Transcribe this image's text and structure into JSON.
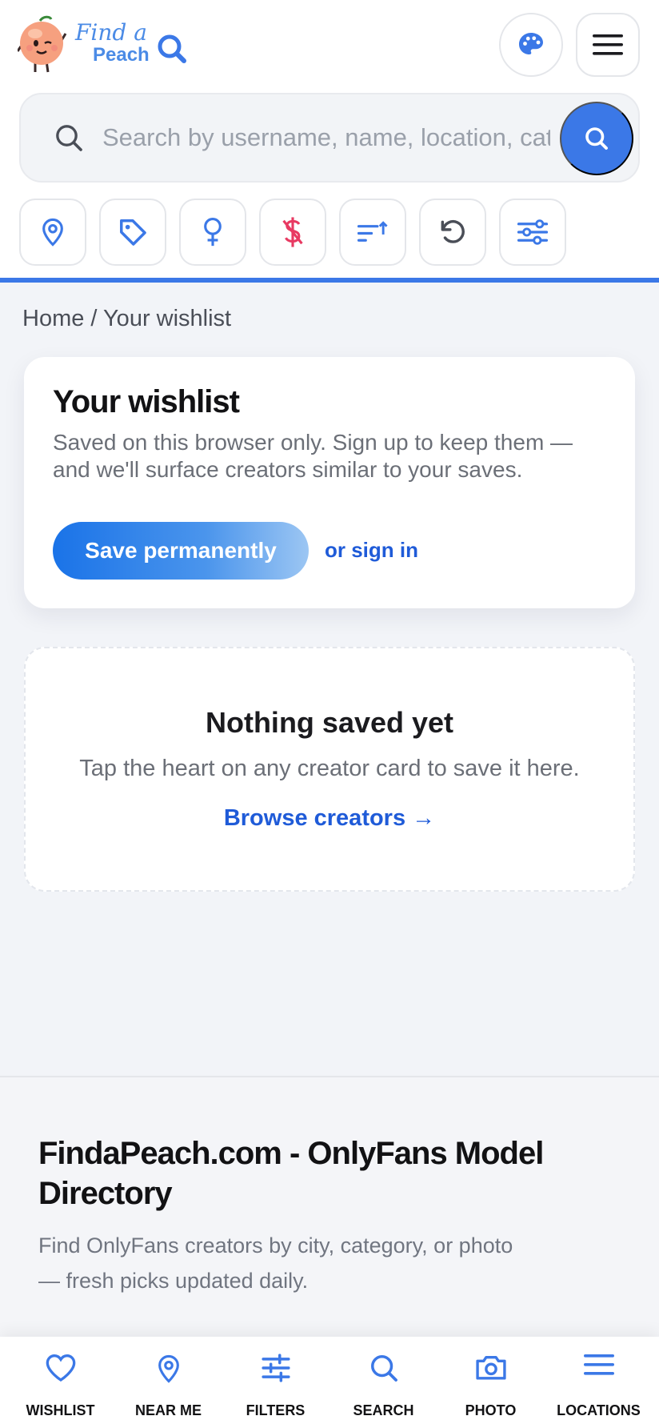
{
  "brand": {
    "line1": "Find a",
    "line2": "Peach",
    "colors": {
      "accent": "#3b78e7",
      "link": "#1f5bd8",
      "peach": "#f6a07f",
      "danger": "#e83a62"
    }
  },
  "header": {
    "theme_icon": "palette-icon",
    "menu_icon": "hamburger-menu-icon"
  },
  "search": {
    "placeholder": "Search by username, name, location, category",
    "value": ""
  },
  "filters": [
    {
      "icon": "location-pin-icon"
    },
    {
      "icon": "tag-icon"
    },
    {
      "icon": "female-symbol-icon"
    },
    {
      "icon": "no-dollar-icon"
    },
    {
      "icon": "sort-icon"
    },
    {
      "icon": "reset-icon"
    },
    {
      "icon": "sliders-icon"
    }
  ],
  "breadcrumb": "Home / Your wishlist",
  "wishlist": {
    "title": "Your wishlist",
    "description": "Saved on this browser only. Sign up to keep them — and we'll surface creators similar to your saves.",
    "save_label": "Save permanently",
    "signin_label": "or sign in"
  },
  "empty_state": {
    "title": "Nothing saved yet",
    "text": "Tap the heart on any creator card to save it here.",
    "link": "Browse creators →"
  },
  "footer": {
    "title": "FindaPeach.com - OnlyFans Model Directory",
    "text": "Find OnlyFans creators by city, category, or photo — fresh picks updated daily."
  },
  "bottom_nav": [
    {
      "label": "WISHLIST",
      "icon": "heart-icon"
    },
    {
      "label": "NEAR ME",
      "icon": "location-pin-icon"
    },
    {
      "label": "FILTERS",
      "icon": "filters-icon"
    },
    {
      "label": "SEARCH",
      "icon": "search-icon"
    },
    {
      "label": "PHOTO",
      "icon": "camera-icon"
    },
    {
      "label": "LOCATIONS",
      "icon": "menu-lines-icon"
    }
  ]
}
